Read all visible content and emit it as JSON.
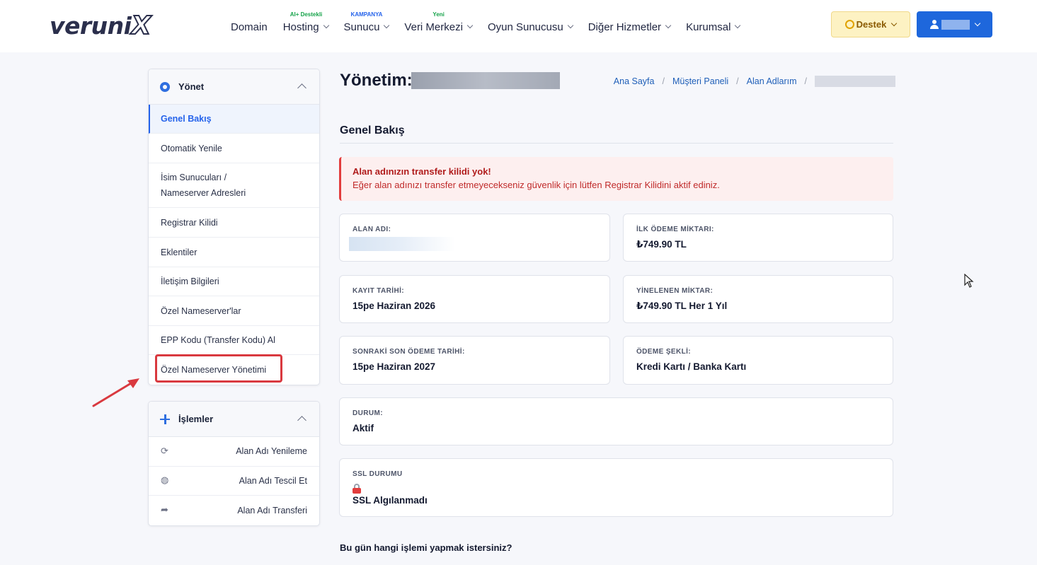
{
  "brand": {
    "logo_main": "veruni",
    "logo_x": "X"
  },
  "nav": [
    {
      "label": "Domain",
      "badge": ""
    },
    {
      "label": "Hosting",
      "badge": "AI+ Destekli",
      "badge_color": "#16a34a"
    },
    {
      "label": "Sunucu",
      "badge": "KAMPANYA",
      "badge_color": "#2563eb"
    },
    {
      "label": "Veri Merkezi",
      "badge": "Yeni",
      "badge_color": "#16a34a"
    },
    {
      "label": "Oyun Sunucusu",
      "badge": ""
    },
    {
      "label": "Diğer Hizmetler",
      "badge": ""
    },
    {
      "label": "Kurumsal",
      "badge": ""
    }
  ],
  "header": {
    "support_label": "Destek"
  },
  "sidebar": {
    "manage_title": "Yönet",
    "items": [
      "Genel Bakış",
      "Otomatik Yenile",
      "İsim Sunucuları / Nameserver Adresleri",
      "Registrar Kilidi",
      "Eklentiler",
      "İletişim Bilgileri",
      "Özel Nameserver'lar",
      "EPP Kodu (Transfer Kodu) Al",
      "Özel Nameserver Yönetimi"
    ],
    "ops_title": "İşlemler",
    "ops": [
      {
        "label": "Alan Adı Yenileme",
        "icon": "refresh-icon"
      },
      {
        "label": "Alan Adı Tescil Et",
        "icon": "globe-icon"
      },
      {
        "label": "Alan Adı Transferi",
        "icon": "share-arrow-icon"
      }
    ]
  },
  "main": {
    "title": "Yönetim:",
    "breadcrumb": [
      "Ana Sayfa",
      "Müşteri Paneli",
      "Alan Adlarım"
    ],
    "section_title": "Genel Bakış",
    "alert": {
      "title": "Alan adınızın transfer kilidi yok!",
      "message": "Eğer alan adınızı transfer etmeyecekseniz güvenlik için lütfen Registrar Kilidini aktif ediniz."
    },
    "cards": {
      "domain_label": "ALAN ADI:",
      "first_payment_label": "İLK ÖDEME MİKTARI:",
      "first_payment_value": "₺749.90 TL",
      "reg_date_label": "KAYIT TARİHİ:",
      "reg_date_value": "15pe Haziran 2026",
      "recurring_label": "YİNELENEN MİKTAR:",
      "recurring_value": "₺749.90 TL Her 1 Yıl",
      "due_date_label": "SONRAKİ SON ÖDEME TARİHİ:",
      "due_date_value": "15pe Haziran 2027",
      "payment_method_label": "ÖDEME ŞEKLİ:",
      "payment_method_value": "Kredi Kartı / Banka Kartı",
      "status_label": "DURUM:",
      "status_value": "Aktif",
      "ssl_label": "SSL DURUMU",
      "ssl_value": "SSL Algılanmadı"
    },
    "question": "Bu gün hangi işlemi yapmak istersiniz?"
  },
  "colors": {
    "accent": "#1e67dc",
    "alert": "#e23d3d",
    "highlight": "#d9393f"
  }
}
